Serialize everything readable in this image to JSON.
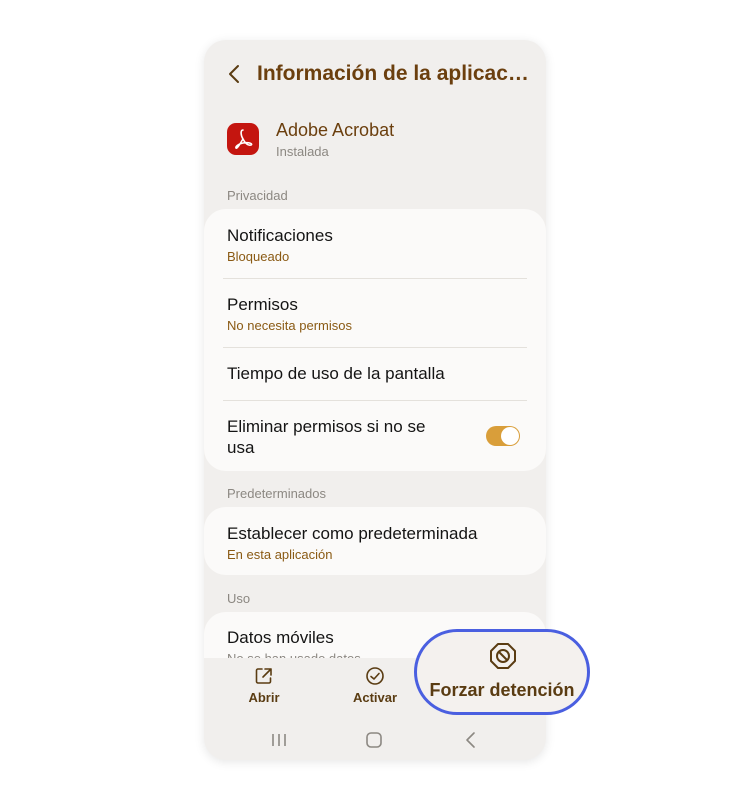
{
  "header": {
    "title": "Información de la aplicac…"
  },
  "app": {
    "name": "Adobe Acrobat",
    "status": "Instalada"
  },
  "sections": {
    "privacy": "Privacidad",
    "defaults": "Predeterminados",
    "usage": "Uso"
  },
  "privacy_items": {
    "notifications": {
      "title": "Notificaciones",
      "sub": "Bloqueado"
    },
    "permissions": {
      "title": "Permisos",
      "sub": "No necesita permisos"
    },
    "screen_time": {
      "title": "Tiempo de uso de la pantalla"
    },
    "remove_permissions": {
      "title_line1": "Eliminar permisos si no se",
      "title_line2": "usa",
      "toggle_on": true
    }
  },
  "defaults_item": {
    "title": "Establecer como predeterminada",
    "sub": "En esta aplicación"
  },
  "usage_item": {
    "title": "Datos móviles",
    "sub": "No se han usado datos"
  },
  "actions": {
    "open": "Abrir",
    "enable": "Activar",
    "force_stop": "Forzar detención"
  },
  "colors": {
    "accent": "#d99e3a",
    "title": "#6b3f0e",
    "highlight": "#4a5fe0",
    "app_icon": "#c4150f"
  },
  "icons": [
    "back-icon",
    "acrobat-icon",
    "open-external-icon",
    "check-circle-icon",
    "stop-icon",
    "recents-icon",
    "home-icon",
    "nav-back-icon"
  ]
}
